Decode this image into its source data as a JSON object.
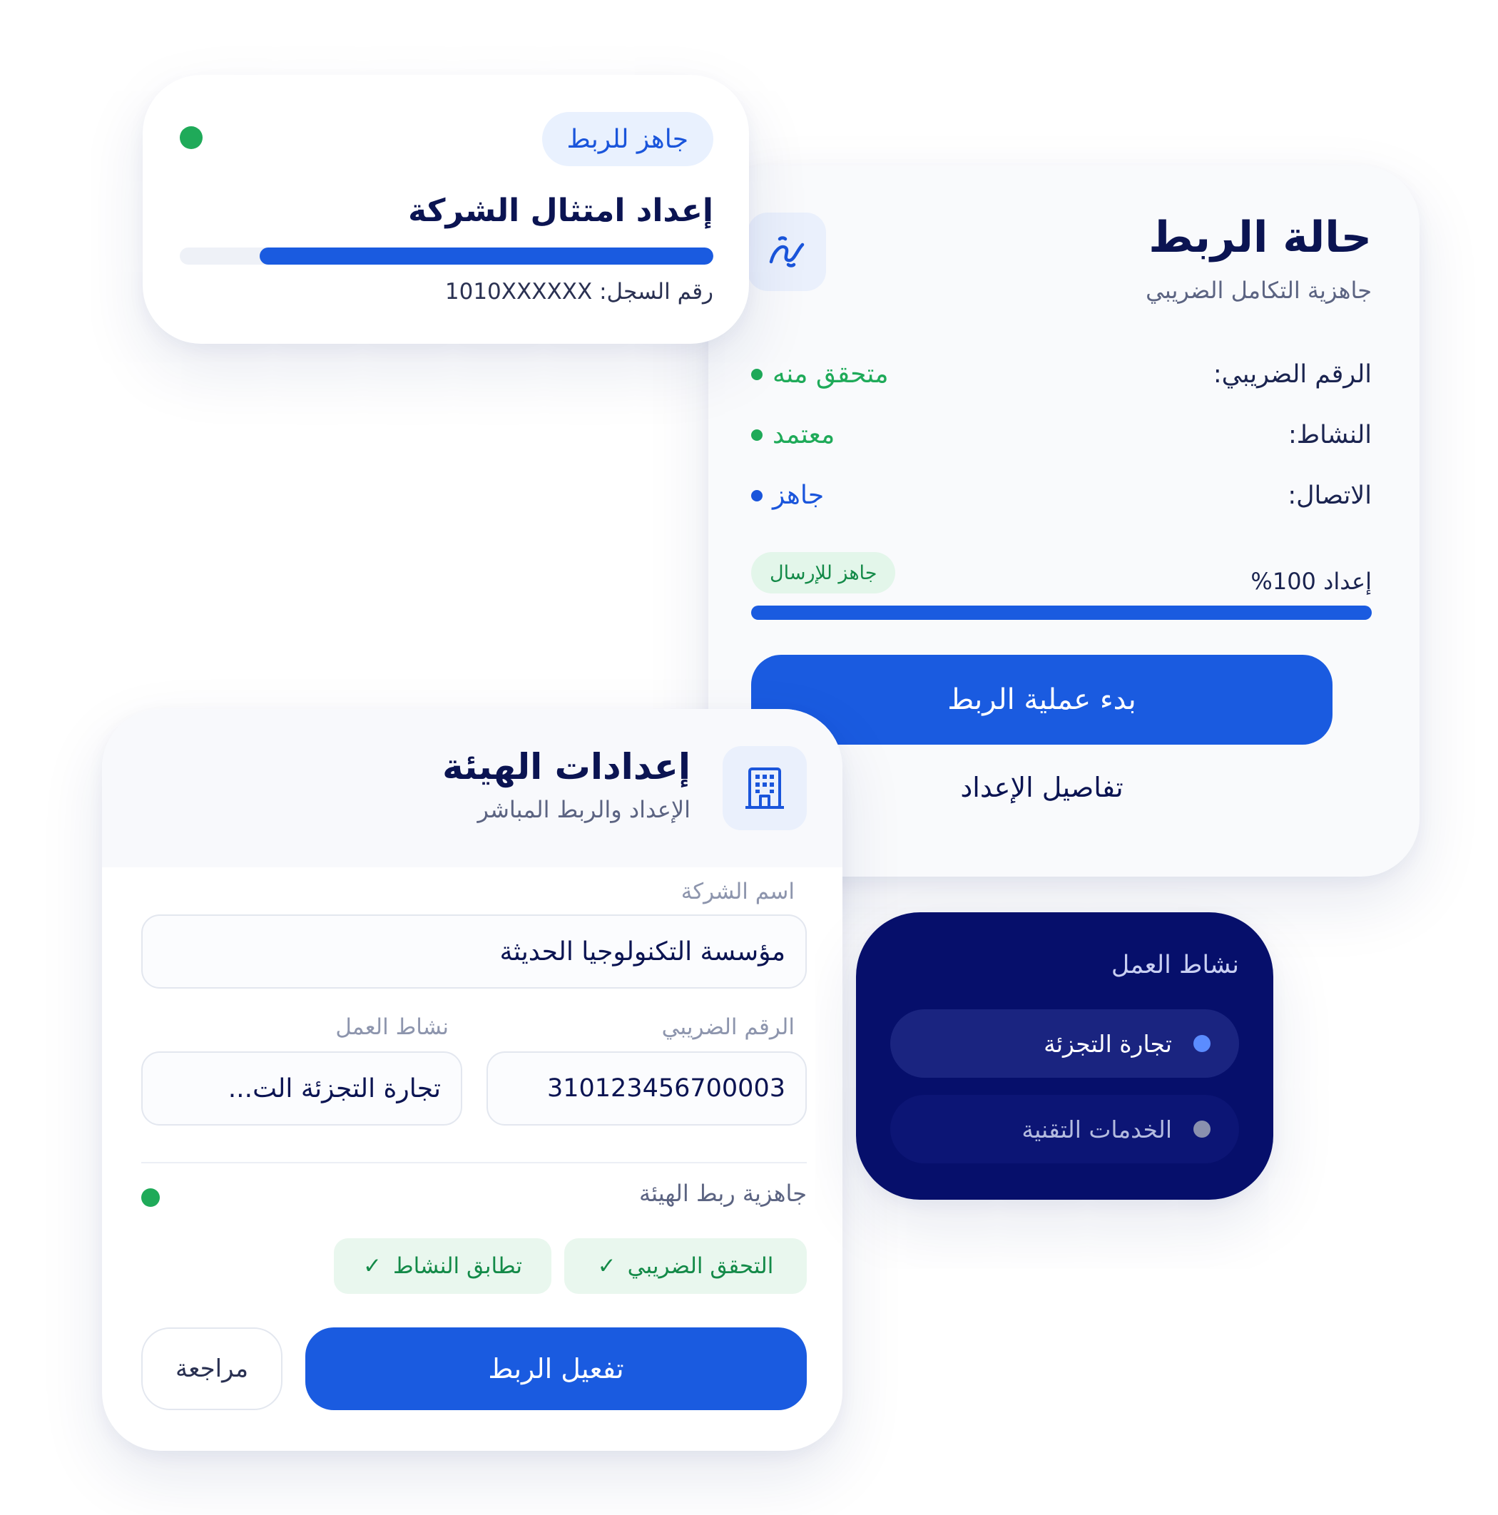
{
  "status_card": {
    "title": "حالة الربط",
    "subtitle": "جاهزية التكامل الضريبي",
    "icon": "link-icon",
    "rows": [
      {
        "label": "الرقم الضريبي:",
        "value": "متحقق منه",
        "status_color": "#1faa59"
      },
      {
        "label": "النشاط:",
        "value": "معتمد",
        "status_color": "#1faa59"
      },
      {
        "label": "الاتصال:",
        "value": "جاهز",
        "status_color": "#1a55db"
      }
    ],
    "progress_label": "إعداد 100%",
    "progress_percent": 100,
    "ready_badge": "جاهز للإرسال",
    "primary_button": "بدء عملية الربط",
    "secondary_link": "تفاصيل الإعداد"
  },
  "compliance_card": {
    "badge": "جاهز للربط",
    "title": "إعداد امتثال الشركة",
    "progress_percent": 85,
    "registration": "رقم السجل: 1010XXXXXX"
  },
  "authority_card": {
    "title": "إعدادات الهيئة",
    "subtitle": "الإعداد والربط المباشر",
    "icon": "building-icon",
    "company_name_label": "اسم الشركة",
    "company_name_value": "مؤسسة التكنولوجيا الحديثة",
    "tax_number_label": "الرقم الضريبي",
    "tax_number_value": "310123456700003",
    "activity_label": "نشاط العمل",
    "activity_value": "تجارة التجزئة الت...",
    "readiness_label": "جاهزية ربط الهيئة",
    "checks": [
      "التحقق الضريبي",
      "تطابق النشاط"
    ],
    "activate_button": "تفعيل الربط",
    "review_button": "مراجعة"
  },
  "activity_dropdown": {
    "title": "نشاط العمل",
    "options": [
      {
        "label": "تجارة التجزئة",
        "selected": true
      },
      {
        "label": "الخدمات التقنية",
        "selected": false
      }
    ]
  },
  "colors": {
    "primary": "#1a5be0",
    "success": "#1faa59",
    "navy": "#0b1452",
    "dark_panel": "#060f6b"
  }
}
